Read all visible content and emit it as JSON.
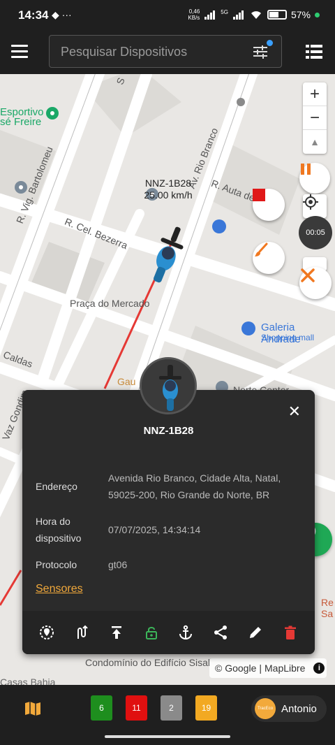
{
  "status_bar": {
    "time": "14:34",
    "net_speed_value": "0,46",
    "net_speed_unit": "KB/s",
    "signal_label": "5G",
    "battery": "57%",
    "battery_level": 0.57
  },
  "search": {
    "placeholder": "Pesquisar Dispositivos"
  },
  "map": {
    "labels": {
      "esportivo": "Esportivo",
      "jose_freire": "sé Freire",
      "rua_bartolomeu": "R. Vig. Bartolomeu",
      "rua_bezerra": "R. Cel. Bezerra",
      "rua_rio_branco": "Av. Rio Branco",
      "rua_auta": "R. Auta de Souza",
      "praca": "Praça do Mercado",
      "galeria": "Galeria Andrade",
      "shopping": "Shopping mall",
      "caldas": "Caldas",
      "condominio": "Condomínio do Edifício Sisal",
      "casas_bahia": "Casas Bahia",
      "gau": "Gau",
      "norte": "Norte Center",
      "vaz_gondim": "Vaz Gondim",
      "s_left": "S",
      "re": "Re",
      "sa": "Sa"
    },
    "vehicle_label_name": "NNZ-1B28",
    "vehicle_label_speed": "25.00 km/h",
    "zoom_in": "+",
    "zoom_out": "−",
    "compass": "▲",
    "timer": "00:05",
    "attribution_google": "© Google",
    "attribution_sep": "|",
    "attribution_maplibre": "MapLibre",
    "attribution_info": "i"
  },
  "popup": {
    "title": "NNZ-1B28",
    "close": "✕",
    "address_label": "Endereço",
    "address_value": "Avenida Rio Branco, Cidade Alta, Natal, 59025-200, Rio Grande do Norte, BR",
    "device_time_label": "Hora do dispositivo",
    "device_time_value": "07/07/2025, 14:34:14",
    "protocol_label": "Protocolo",
    "protocol_value": "gt06",
    "sensors_link": "Sensores"
  },
  "bottom_bar": {
    "counts": [
      {
        "value": "6",
        "color": "#1e8e1e"
      },
      {
        "value": "11",
        "color": "#e01010"
      },
      {
        "value": "2",
        "color": "#8a8a8a"
      },
      {
        "value": "19",
        "color": "#f2a922"
      }
    ],
    "user_name": "Antonio",
    "user_logo_text": "TracEco"
  },
  "colors": {
    "accent_orange": "#f2a93b",
    "route_red": "#e53935",
    "whatsapp_green": "#1fa855"
  }
}
